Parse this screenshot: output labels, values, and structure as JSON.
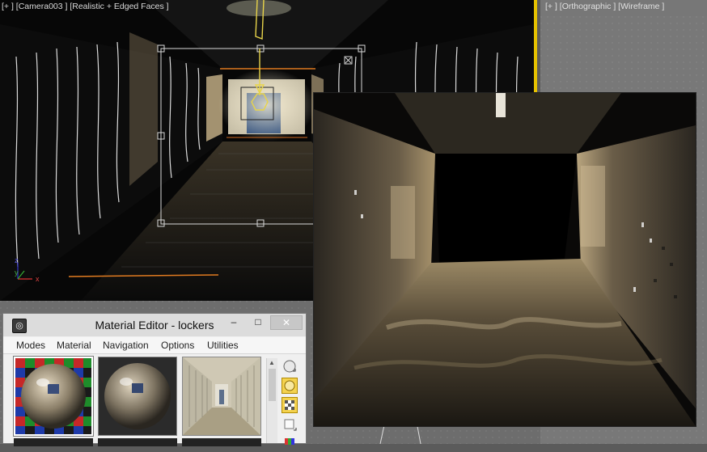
{
  "camera_viewport": {
    "label": "[+ ] [Camera003 ] [Realistic + Edged Faces ]"
  },
  "ortho_viewport": {
    "label": "[+ ] [Orthographic ] [Wireframe ]"
  },
  "gizmo_axes": {
    "x": "x",
    "y": "y",
    "z": "z"
  },
  "material_editor": {
    "title": "Material Editor - lockers",
    "window_buttons": {
      "minimize": "–",
      "maximize": "□",
      "close": "✕"
    },
    "menu": [
      "Modes",
      "Material",
      "Navigation",
      "Options",
      "Utilities"
    ],
    "slots": [
      {
        "name": "checker-sphere",
        "active": true
      },
      {
        "name": "sphere",
        "active": false
      },
      {
        "name": "hallway-bitmap",
        "active": false
      }
    ],
    "tools": [
      "sample-type-sphere",
      "backlight",
      "background-checker",
      "sample-uv-tiling",
      "video-color-check"
    ]
  },
  "colors": {
    "active_viewport_border": "#e6c200",
    "viewport_bg": "#080808",
    "ortho_bg": "#777777",
    "selected_tool": "#f4d24e"
  }
}
